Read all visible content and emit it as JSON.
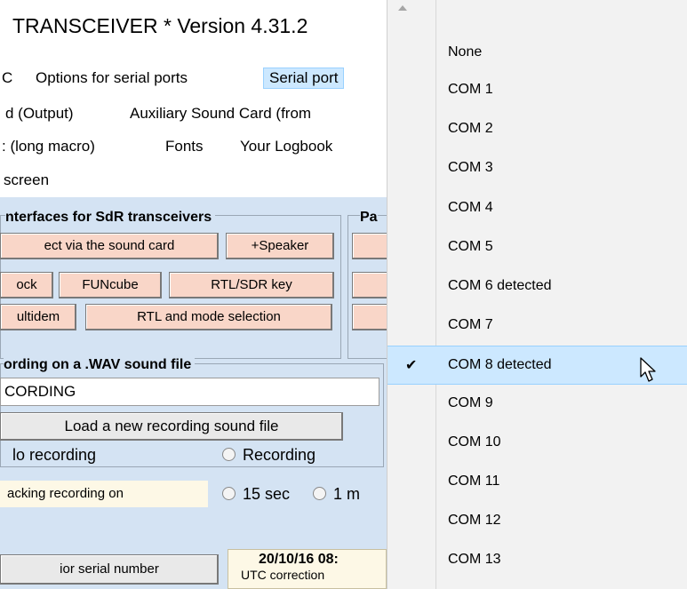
{
  "app": {
    "title": "TRANSCEIVER *   Version 4.31.2",
    "menu": {
      "row1": [
        "C",
        "Options for serial ports",
        "Serial port"
      ],
      "row2": [
        "d (Output)",
        "Auxiliary Sound Card (from"
      ],
      "row3": [
        ": (long macro)",
        "Fonts",
        "Your Logbook"
      ],
      "row4": [
        "screen"
      ]
    },
    "sdr_group": {
      "title": "nterfaces for SdR transceivers",
      "buttons": [
        "ect via the sound card",
        "+Speaker",
        "ock",
        "FUNcube",
        "RTL/SDR key",
        "ultidem",
        "RTL and mode selection"
      ]
    },
    "right_group_title": "Pa",
    "recording": {
      "title": "ording on a .WAV sound file",
      "field_value": "CORDING",
      "load_button": "Load a new recording sound file",
      "radio_no": "lo recording",
      "radio_rec": "Recording",
      "tracking_label": "acking recording on",
      "opt_15": "15 sec",
      "opt_1": "1 m"
    },
    "serial_button": "ior serial number",
    "datetime": "20/10/16 08:",
    "utc": "UTC correction"
  },
  "dropdown": {
    "items": [
      {
        "label": "None",
        "checked": false
      },
      {
        "label": "COM 1",
        "checked": false
      },
      {
        "label": "COM 2",
        "checked": false
      },
      {
        "label": "COM 3",
        "checked": false
      },
      {
        "label": "COM 4",
        "checked": false
      },
      {
        "label": "COM 5",
        "checked": false
      },
      {
        "label": "COM 6 detected",
        "checked": false
      },
      {
        "label": "COM 7",
        "checked": false
      },
      {
        "label": "COM 8 detected",
        "checked": true
      },
      {
        "label": "COM 9",
        "checked": false
      },
      {
        "label": "COM 10",
        "checked": false
      },
      {
        "label": "COM 11",
        "checked": false
      },
      {
        "label": "COM 12",
        "checked": false
      },
      {
        "label": "COM 13",
        "checked": false
      }
    ],
    "check_glyph": "✔",
    "icons": {
      "scroll": "scroll-up-arrow-icon",
      "cursor": "mouse-pointer-icon"
    }
  },
  "colors": {
    "selection": "#cce8ff",
    "panel": "#d4e3f3",
    "button": "#f9d6c8"
  }
}
